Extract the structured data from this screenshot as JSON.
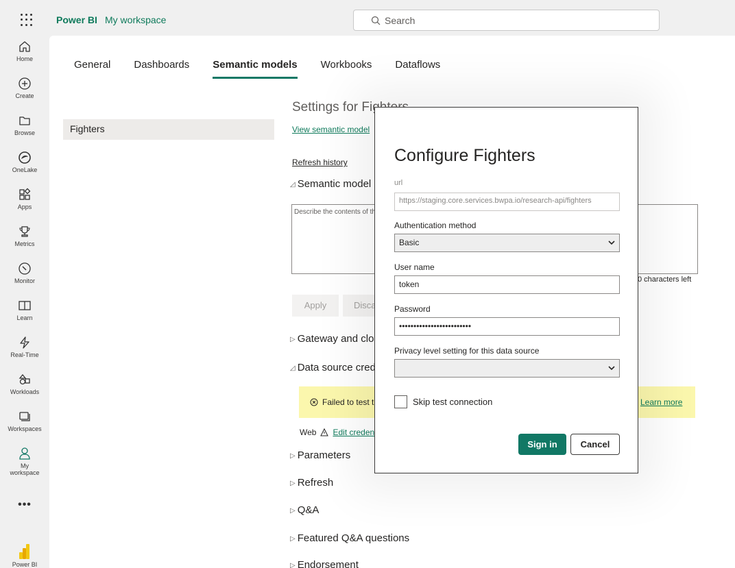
{
  "header": {
    "brand": "Power BI",
    "workspace": "My workspace",
    "search_placeholder": "Search"
  },
  "nav": {
    "items": [
      {
        "label": "Home",
        "icon": "home-icon"
      },
      {
        "label": "Create",
        "icon": "plus-circle-icon"
      },
      {
        "label": "Browse",
        "icon": "folder-icon"
      },
      {
        "label": "OneLake",
        "icon": "onelake-icon"
      },
      {
        "label": "Apps",
        "icon": "apps-icon"
      },
      {
        "label": "Metrics",
        "icon": "trophy-icon"
      },
      {
        "label": "Monitor",
        "icon": "monitor-icon"
      },
      {
        "label": "Learn",
        "icon": "book-icon"
      },
      {
        "label": "Real-Time",
        "icon": "lightning-icon"
      },
      {
        "label": "Workloads",
        "icon": "workloads-icon"
      },
      {
        "label": "Workspaces",
        "icon": "workspaces-icon"
      },
      {
        "label": "My workspace",
        "icon": "person-icon"
      }
    ],
    "more": "•••",
    "footer_label": "Power BI"
  },
  "tabs": [
    "General",
    "Dashboards",
    "Semantic models",
    "Workbooks",
    "Dataflows"
  ],
  "active_tab": "Semantic models",
  "models": [
    "Fighters"
  ],
  "settings": {
    "title": "Settings for Fighters",
    "view_link": "View semantic model",
    "refresh_history": "Refresh history",
    "semantic_section": "Semantic model description",
    "description_placeholder": "Describe the contents of this semantic model",
    "chars_left": "0 characters left",
    "apply": "Apply",
    "discard": "Discard",
    "gateway_section": "Gateway and cloud connections",
    "datasource_section": "Data source credentials",
    "warning_text": "Failed to test the connection to your data source.",
    "learn_more": "Learn more",
    "web_label": "Web",
    "edit_credentials": "Edit credentials",
    "sections": [
      "Parameters",
      "Refresh",
      "Q&A",
      "Featured Q&A questions",
      "Endorsement"
    ]
  },
  "modal": {
    "title": "Configure Fighters",
    "url_label": "url",
    "url_value": "https://staging.core.services.bwpa.io/research-api/fighters",
    "auth_label": "Authentication method",
    "auth_value": "Basic",
    "username_label": "User name",
    "username_value": "token",
    "password_label": "Password",
    "password_value": "•••••••••••••••••••••••••",
    "privacy_label": "Privacy level setting for this data source",
    "privacy_value": "",
    "skip_label": "Skip test connection",
    "skip_checked": false,
    "signin": "Sign in",
    "cancel": "Cancel"
  },
  "colors": {
    "accent": "#117865",
    "link": "#0e7a5b",
    "warning_bg": "#fbf7ad"
  }
}
